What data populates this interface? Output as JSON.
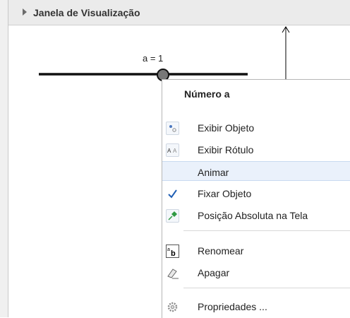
{
  "view": {
    "title": "Janela de Visualização"
  },
  "slider": {
    "label": "a = 1"
  },
  "context_menu": {
    "header": "Número a",
    "items": [
      {
        "label": "Exibir Objeto",
        "icon": "show-object-icon"
      },
      {
        "label": "Exibir Rótulo",
        "icon": "show-label-icon"
      },
      {
        "label": "Animar",
        "icon": "none"
      },
      {
        "label": "Fixar Objeto",
        "icon": "checkmark-icon"
      },
      {
        "label": "Posição Absoluta na Tela",
        "icon": "pin-icon"
      },
      {
        "label": "Renomear",
        "icon": "rename-icon"
      },
      {
        "label": "Apagar",
        "icon": "eraser-icon"
      },
      {
        "label": "Propriedades ...",
        "icon": "gear-icon"
      }
    ]
  },
  "colors": {
    "highlight": "#eaf1fb",
    "check": "#1f5fb5",
    "pin": "#2f9a43"
  }
}
